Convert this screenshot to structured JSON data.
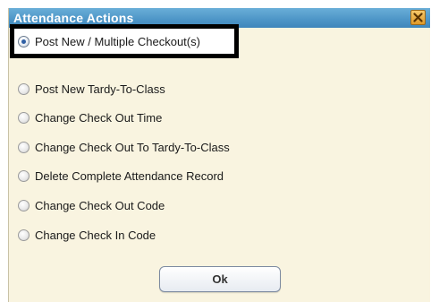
{
  "dialog": {
    "title": "Attendance Actions",
    "close_icon": "close-icon"
  },
  "options": [
    {
      "label": "Post New / Multiple Checkout(s)",
      "checked": true
    },
    {
      "label": "Post New Tardy-To-Class",
      "checked": false
    },
    {
      "label": "Change Check Out Time",
      "checked": false
    },
    {
      "label": "Change Check Out To Tardy-To-Class",
      "checked": false
    },
    {
      "label": "Delete Complete Attendance Record",
      "checked": false
    },
    {
      "label": "Change Check Out Code",
      "checked": false
    },
    {
      "label": "Change Check In Code",
      "checked": false
    }
  ],
  "ok_label": "Ok",
  "colors": {
    "titlebar": "#4f97c8",
    "panel": "#f9f4e0",
    "highlight_border": "#000000"
  }
}
